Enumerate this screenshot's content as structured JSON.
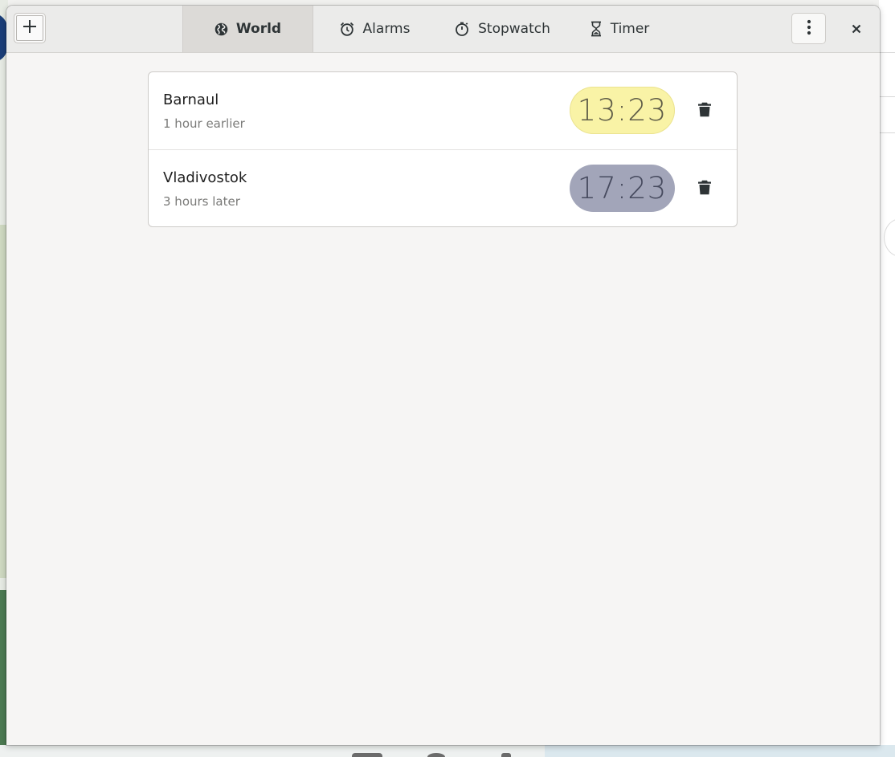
{
  "header": {
    "tabs": [
      {
        "label": "World",
        "icon": "globe-icon",
        "active": true
      },
      {
        "label": "Alarms",
        "icon": "alarm-icon",
        "active": false
      },
      {
        "label": "Stopwatch",
        "icon": "stopwatch-icon",
        "active": false
      },
      {
        "label": "Timer",
        "icon": "hourglass-icon",
        "active": false
      }
    ],
    "add_icon": "plus-icon",
    "menu_icon": "vertical-dots-icon",
    "close_icon": "close-icon"
  },
  "world": {
    "clocks": [
      {
        "city": "Barnaul",
        "offset": "1 hour earlier",
        "time": "13:23",
        "period": "day",
        "pill_color": "#f9f3a6"
      },
      {
        "city": "Vladivostok",
        "offset": "3 hours later",
        "time": "17:23",
        "period": "night",
        "pill_color": "#a2a5b9"
      }
    ],
    "delete_icon": "trash-icon"
  }
}
